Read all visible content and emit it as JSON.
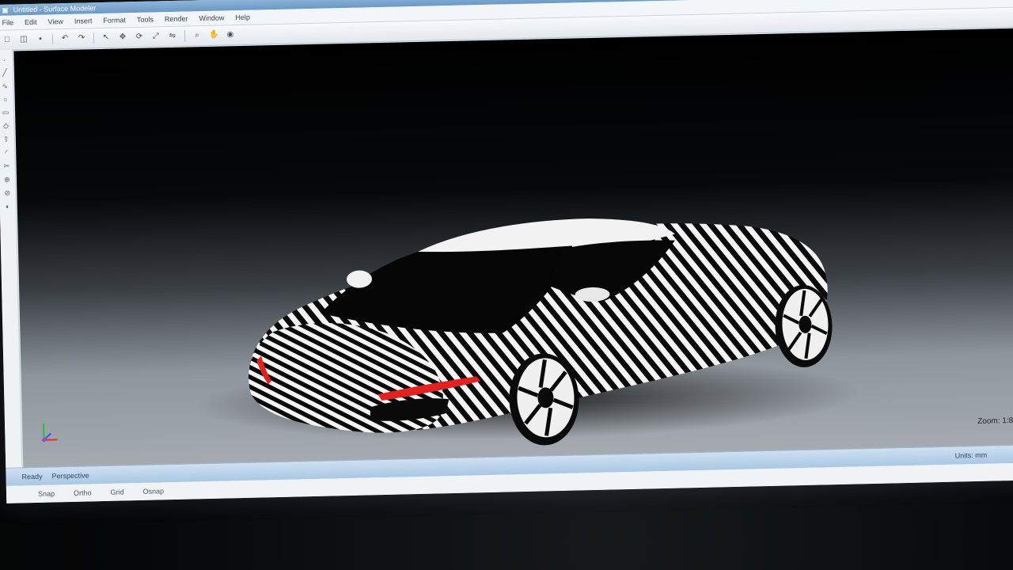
{
  "window": {
    "title": "Untitled - Surface Modeler"
  },
  "menu": {
    "items": [
      "File",
      "Edit",
      "View",
      "Insert",
      "Format",
      "Tools",
      "Render",
      "Window",
      "Help"
    ]
  },
  "toolbar": {
    "icons": [
      "new-icon",
      "open-icon",
      "save-icon",
      "undo-icon",
      "redo-icon",
      "select-icon",
      "move-icon",
      "rotate-icon",
      "scale-icon",
      "mirror-icon",
      "zoom-icon",
      "pan-icon",
      "render-icon"
    ]
  },
  "viewport": {
    "zoom_label": "Zoom: 1:8",
    "model": "concept sports car with zebra-stripe analysis shading"
  },
  "statusbar": {
    "left": "Ready",
    "mode": "Perspective",
    "right": "Units: mm"
  },
  "bottombar": {
    "items": [
      "Snap",
      "Ortho",
      "Grid",
      "Osnap"
    ]
  },
  "colors": {
    "accent": "#6c98c6",
    "tail_light": "#e2221f",
    "stripe": "#ffffff",
    "background": "#000000"
  }
}
